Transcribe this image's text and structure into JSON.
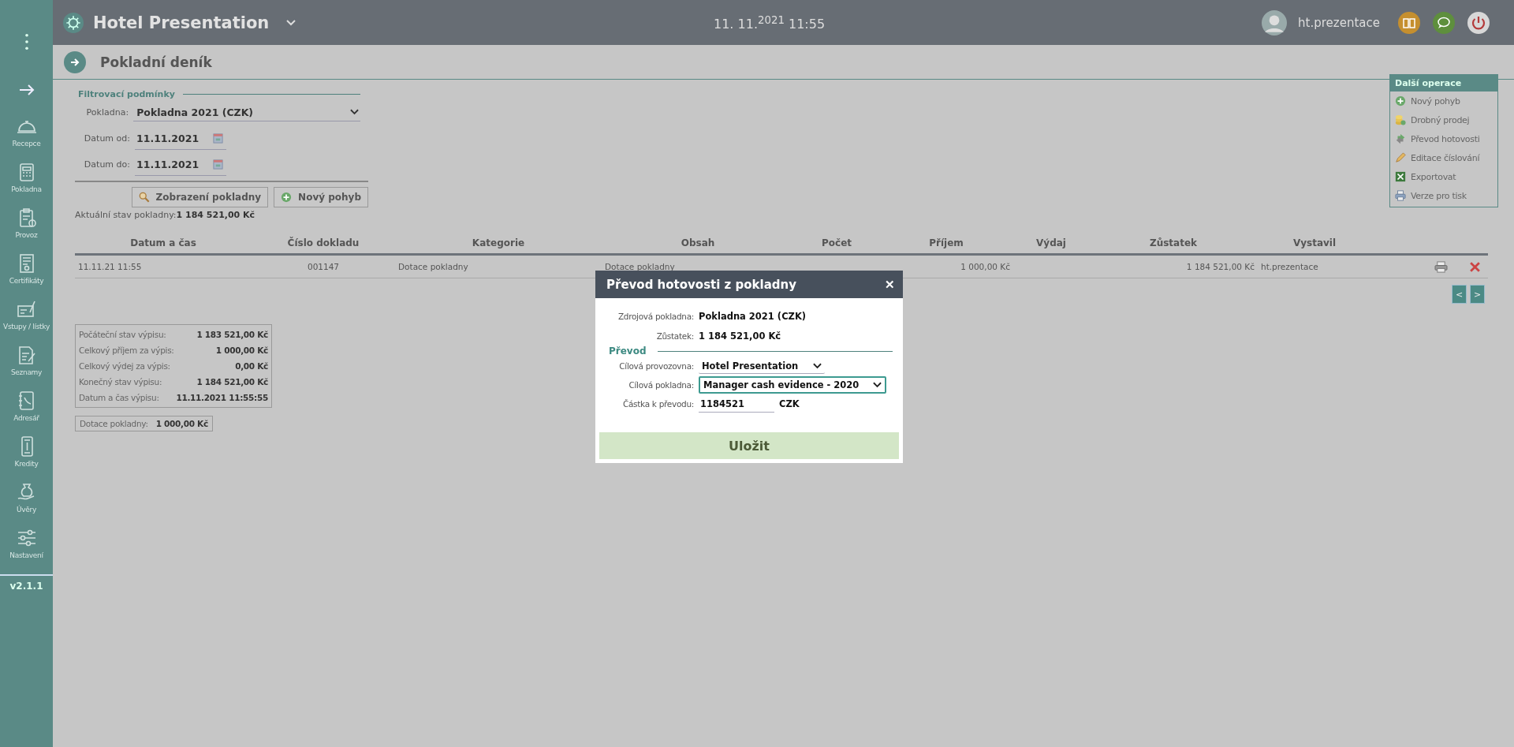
{
  "topbar": {
    "title": "Hotel Presentation",
    "datetime": "11. 11.$^{2021}$ 11:55",
    "username": "ht.prezentace"
  },
  "sidebar": {
    "items": [
      {
        "label": "Recepce"
      },
      {
        "label": "Pokladna"
      },
      {
        "label": "Provoz"
      },
      {
        "label": "Certifikáty"
      },
      {
        "label": "Vstupy / lístky"
      },
      {
        "label": "Seznamy"
      },
      {
        "label": "Adresář"
      },
      {
        "label": "Kredity"
      },
      {
        "label": "Úvěry"
      },
      {
        "label": "Nastavení"
      }
    ],
    "version": "v2.1.1"
  },
  "page": {
    "title": "Pokladní deník"
  },
  "filter": {
    "title": "Filtrovací podmínky",
    "fields": [
      {
        "label": "Pokladna:",
        "value": "Pokladna 2021 (CZK)",
        "kind": "select"
      },
      {
        "label": "Datum od:",
        "value": "11.11.2021",
        "kind": "date"
      },
      {
        "label": "Datum do:",
        "value": "11.11.2021",
        "kind": "date"
      }
    ],
    "buttons": [
      {
        "label": "Zobrazení pokladny"
      },
      {
        "label": "Nový pohyb"
      }
    ],
    "balance_label": "Aktuální stav pokladny:",
    "balance_value": "1 184 521,00 Kč"
  },
  "table": {
    "columns": [
      "Datum a čas",
      "Číslo dokladu",
      "Kategorie",
      "Obsah",
      "Počet",
      "Příjem",
      "Výdaj",
      "Zůstatek",
      "Vystavil"
    ],
    "rows": [
      {
        "cells": [
          "11.11.21 11:55",
          "001147",
          "Dotace pokladny",
          "Dotace pokladny",
          "",
          "1 000,00 Kč",
          "",
          "1 184 521,00 Kč",
          "ht.prezentace"
        ]
      }
    ],
    "pager": [
      "<",
      ">"
    ]
  },
  "summary": [
    {
      "label": "Počáteční stav výpisu:",
      "value": "1 183 521,00 Kč"
    },
    {
      "label": "Celkový příjem za výpis:",
      "value": "1 000,00 Kč"
    },
    {
      "label": "Celkový výdej za výpis:",
      "value": "0,00 Kč"
    },
    {
      "label": "Konečný stav výpisu:",
      "value": "1 184 521,00 Kč"
    },
    {
      "label": "Datum a čas výpisu:",
      "value": "11.11.2021 11:55:55"
    }
  ],
  "category_totals": [
    {
      "label": "Dotace pokladny:",
      "value": "1 000,00 Kč"
    }
  ],
  "operations": {
    "title": "Další operace",
    "items": [
      {
        "label": "Nový pohyb"
      },
      {
        "label": "Drobný prodej"
      },
      {
        "label": "Převod hotovosti"
      },
      {
        "label": "Editace číslování"
      },
      {
        "label": "Exportovat"
      },
      {
        "label": "Verze pro tisk"
      }
    ]
  },
  "dialog": {
    "title": "Převod hotovosti z pokladny",
    "close": "✕",
    "source_label": "Zdrojová pokladna:",
    "source_value": "Pokladna 2021 (CZK)",
    "balance_label": "Zůstatek:",
    "balance_value": "1 184 521,00 Kč",
    "section": "Převod",
    "fields": [
      {
        "label": "Cílová provozovna:",
        "value": "Hotel Presentation",
        "kind": "select",
        "focused": false
      },
      {
        "label": "Cílová pokladna:",
        "value": "Manager cash evidence - 2020",
        "kind": "select",
        "focused": true
      },
      {
        "label": "Částka k převodu:",
        "value": "1184521",
        "kind": "input",
        "focused": false,
        "unit": "CZK"
      }
    ],
    "save": "Uložit"
  }
}
